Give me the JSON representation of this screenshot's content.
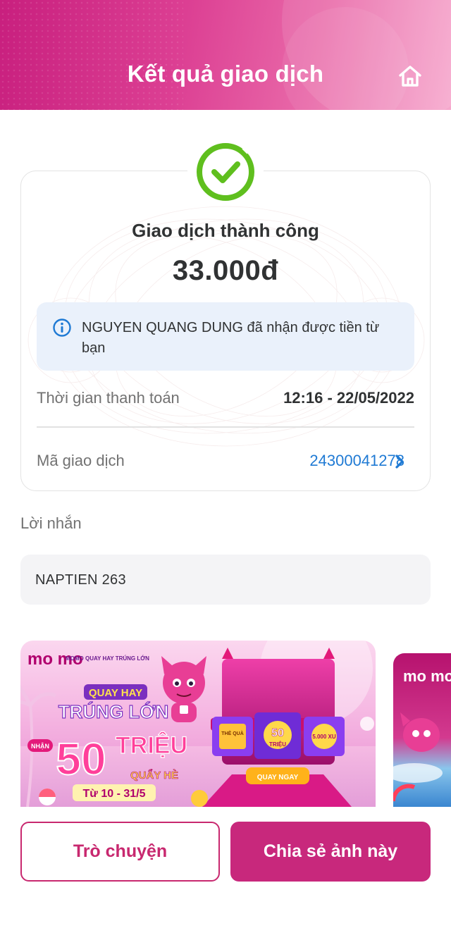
{
  "header": {
    "title": "Kết quả giao dịch",
    "home_icon": "home-icon"
  },
  "receipt": {
    "status_icon": "check-circle-icon",
    "status": "Giao dịch thành công",
    "amount": "33.000đ",
    "info_icon": "info-icon",
    "info_message": "NGUYEN QUANG DUNG đã nhận được tiền từ bạn",
    "rows": [
      {
        "label": "Thời gian thanh toán",
        "value": "12:16 - 22/05/2022"
      },
      {
        "label": "Mã giao dịch",
        "value": "24300041278"
      }
    ]
  },
  "message": {
    "label": "Lời nhắn",
    "value": "NAPTIEN 263"
  },
  "banners": [
    {
      "brand": "mo mo",
      "campaign_small": "MOMO QUAY HAY TRÚNG LỚN",
      "headline_top": "QUAY HAY",
      "headline_bottom": "TRÚNG LỚN",
      "prize_prefix": "NHẬN",
      "prize_number": "50",
      "prize_unit": "TRIỆU",
      "prize_suffix": "QUẨY HÈ",
      "dates": "Từ 10 - 31/5",
      "tile_left": "THẺ QUÀ",
      "tile_center_number": "50",
      "tile_center_unit": "TRIỆU",
      "tile_right": "5.000 XU",
      "cta": "QUAY NGAY"
    },
    {
      "brand": "mo mo"
    }
  ],
  "actions": {
    "chat": "Trò chuyện",
    "share": "Chia sẻ ảnh này"
  },
  "colors": {
    "brand": "#c8287c",
    "link": "#1f7ad4",
    "success": "#5fbf1e"
  }
}
